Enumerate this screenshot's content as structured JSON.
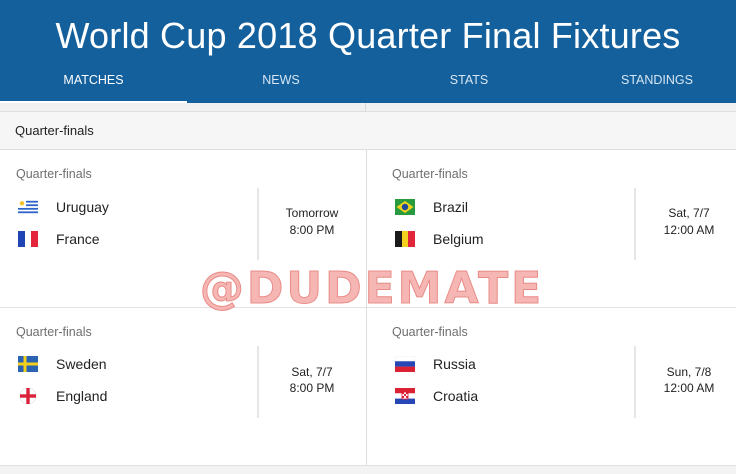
{
  "page": {
    "title": "World Cup 2018 Quarter Final Fixtures"
  },
  "tabs": [
    {
      "label": "MATCHES",
      "active": true
    },
    {
      "label": "NEWS",
      "active": false
    },
    {
      "label": "STATS",
      "active": false
    },
    {
      "label": "STANDINGS",
      "active": false
    }
  ],
  "section": {
    "heading": "Quarter-finals"
  },
  "matches": [
    {
      "stage": "Quarter-finals",
      "home": {
        "name": "Uruguay",
        "flag": "uruguay-flag"
      },
      "away": {
        "name": "France",
        "flag": "france-flag"
      },
      "date": "Tomorrow",
      "time": "8:00 PM"
    },
    {
      "stage": "Quarter-finals",
      "home": {
        "name": "Brazil",
        "flag": "brazil-flag"
      },
      "away": {
        "name": "Belgium",
        "flag": "belgium-flag"
      },
      "date": "Sat, 7/7",
      "time": "12:00 AM"
    },
    {
      "stage": "Quarter-finals",
      "home": {
        "name": "Sweden",
        "flag": "sweden-flag"
      },
      "away": {
        "name": "England",
        "flag": "england-flag"
      },
      "date": "Sat, 7/7",
      "time": "8:00 PM"
    },
    {
      "stage": "Quarter-finals",
      "home": {
        "name": "Russia",
        "flag": "russia-flag"
      },
      "away": {
        "name": "Croatia",
        "flag": "croatia-flag"
      },
      "date": "Sun, 7/8",
      "time": "12:00 AM"
    }
  ],
  "watermark": {
    "text": "@DUDEMATE"
  },
  "colors": {
    "header": "#14609d",
    "watermark": "#f6b6b3"
  }
}
